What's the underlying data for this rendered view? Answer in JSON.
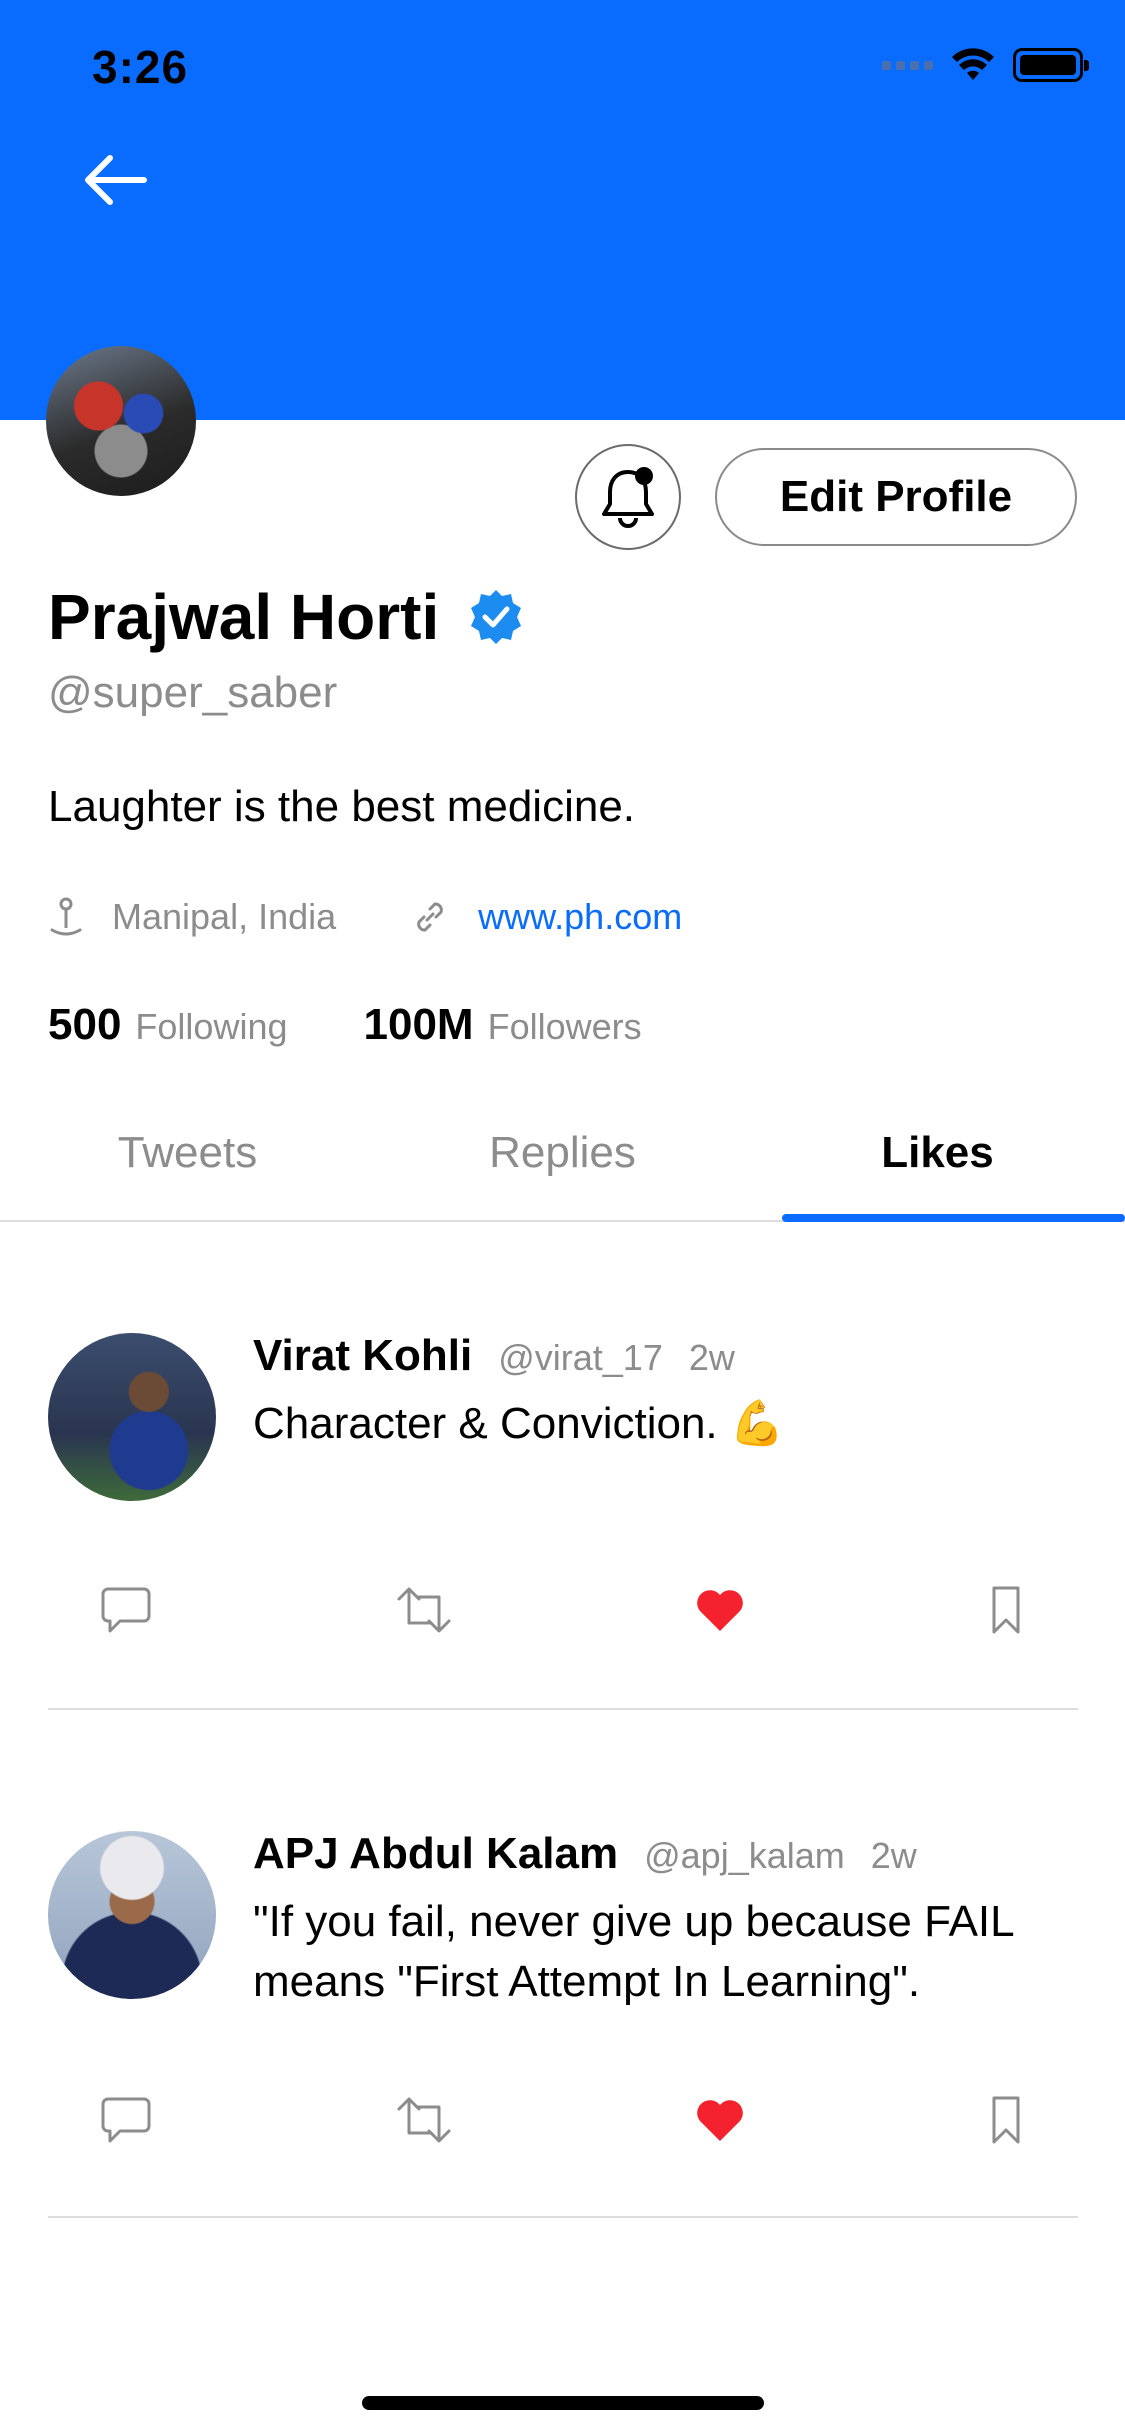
{
  "status_bar": {
    "time": "3:26"
  },
  "header": {
    "banner_color": "#0a6cff",
    "back_icon": "arrow-left-icon"
  },
  "profile": {
    "name": "Prajwal Horti",
    "verified": true,
    "handle": "@super_saber",
    "bio": "Laughter is the best medicine.",
    "location": "Manipal, India",
    "website": "www.ph.com",
    "following_count": "500",
    "following_label": "Following",
    "followers_count": "100M",
    "followers_label": "Followers",
    "edit_button": "Edit Profile",
    "notification_icon": "bell-icon"
  },
  "tabs": [
    {
      "label": "Tweets",
      "active": false
    },
    {
      "label": "Replies",
      "active": false
    },
    {
      "label": "Likes",
      "active": true
    }
  ],
  "tweets": [
    {
      "name": "Virat Kohli",
      "handle": "@virat_17",
      "time": "2w",
      "text": "Character & Conviction. 💪",
      "liked": true
    },
    {
      "name": "APJ Abdul Kalam",
      "handle": "@apj_kalam",
      "time": "2w",
      "text": "\"If you fail, never give up because FAIL means \"First Attempt In Learning\".",
      "liked": true
    }
  ],
  "colors": {
    "accent": "#0a6cff",
    "like": "#f4212e",
    "muted": "#8c8c8c"
  }
}
